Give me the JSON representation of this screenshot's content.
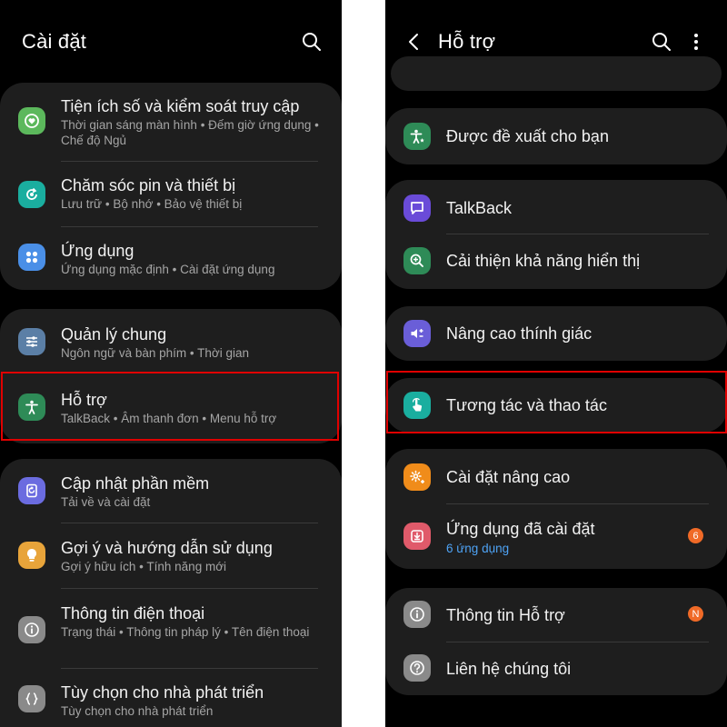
{
  "left_screen": {
    "title": "Cài đặt",
    "groups": [
      {
        "items": [
          {
            "title": "Tiện ích số và kiểm soát truy cập",
            "subtitle": "Thời gian sáng màn hình  •  Đếm giờ ứng dụng  •  Chế độ Ngủ",
            "icon": "digital-wellbeing-icon",
            "color": "#5cb85c"
          },
          {
            "title": "Chăm sóc pin và thiết bị",
            "subtitle": "Lưu trữ  •  Bộ nhớ  •  Bảo vệ thiết bị",
            "icon": "device-care-icon",
            "color": "#1aae9f"
          },
          {
            "title": "Ứng dụng",
            "subtitle": "Ứng dụng mặc định  •  Cài đặt ứng dụng",
            "icon": "apps-icon",
            "color": "#4a8fe7"
          }
        ]
      },
      {
        "items": [
          {
            "title": "Quản lý chung",
            "subtitle": "Ngôn ngữ và bàn phím  •  Thời gian",
            "icon": "general-management-icon",
            "color": "#5b7fa6"
          },
          {
            "title": "Hỗ trợ",
            "subtitle": "TalkBack  •  Âm thanh đơn  •  Menu hỗ trợ",
            "icon": "accessibility-icon",
            "color": "#2e8b57"
          }
        ]
      },
      {
        "items": [
          {
            "title": "Cập nhật phần mềm",
            "subtitle": "Tải về và cài đặt",
            "icon": "software-update-icon",
            "color": "#6b6ce0"
          },
          {
            "title": "Gợi ý và hướng dẫn sử dụng",
            "subtitle": "Gợi ý hữu ích  •  Tính năng mới",
            "icon": "tips-icon",
            "color": "#e8a43a"
          },
          {
            "title": "Thông tin điện thoại",
            "subtitle": "Trạng thái  •  Thông tin pháp lý  •  Tên điện thoại",
            "icon": "info-icon",
            "color": "#8a8a8a"
          },
          {
            "title": "Tùy chọn cho nhà phát triển",
            "subtitle": "Tùy chọn cho nhà phát triển",
            "icon": "developer-options-icon",
            "color": "#8a8a8a"
          }
        ]
      }
    ]
  },
  "right_screen": {
    "title": "Hỗ trợ",
    "items": [
      {
        "title": "Được đề xuất cho bạn",
        "icon": "recommended-icon",
        "color": "#2e8b57"
      },
      {
        "title": "TalkBack",
        "icon": "talkback-icon",
        "color": "#6a4bd8"
      },
      {
        "title": "Cải thiện khả năng hiển thị",
        "icon": "visibility-enhancements-icon",
        "color": "#2e8b57"
      },
      {
        "title": "Nâng cao thính giác",
        "icon": "hearing-enhancements-icon",
        "color": "#6a5ed8"
      },
      {
        "title": "Tương tác và thao tác",
        "icon": "interaction-dexterity-icon",
        "color": "#1aae9f"
      },
      {
        "title": "Cài đặt nâng cao",
        "icon": "advanced-settings-icon",
        "color": "#f08c1a"
      },
      {
        "title": "Ứng dụng đã cài đặt",
        "subtitle": "6 ứng dụng",
        "badge": "6",
        "icon": "installed-apps-icon",
        "color": "#e05a6a"
      },
      {
        "title": "Thông tin Hỗ trợ",
        "badge": "N",
        "icon": "info-icon",
        "color": "#8a8a8a"
      },
      {
        "title": "Liên hệ chúng tôi",
        "icon": "contact-us-icon",
        "color": "#8a8a8a"
      }
    ]
  },
  "colors": {
    "background": "#000000",
    "card": "#1e1e1e",
    "highlight": "#e00000",
    "badge": "#f06a27",
    "link": "#4ea3f5"
  }
}
